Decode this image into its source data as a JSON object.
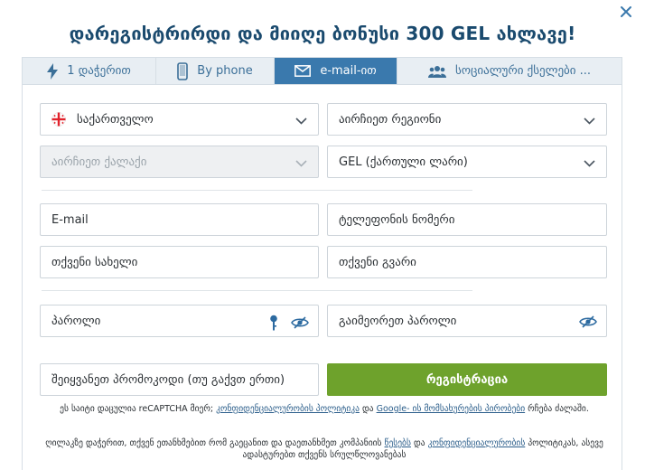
{
  "title": "დარეგისტრირდი და მიიღე ბონუსი 300 GEL ახლავე!",
  "tabs": [
    {
      "label": "1 დაჭერით",
      "icon": "lightning-icon",
      "active": false
    },
    {
      "label": "By phone",
      "icon": "phone-icon",
      "active": false
    },
    {
      "label": "e-mail-ით",
      "icon": "envelope-icon",
      "active": true
    },
    {
      "label": "სოციალური ქსელები ...",
      "icon": "users-icon",
      "active": false
    }
  ],
  "form": {
    "country": "საქართველო",
    "region": "აირჩიეთ რეგიონი",
    "city": "აირჩიეთ ქალაქი",
    "currency": "GEL (ქართული ლარი)",
    "email_placeholder": "E-mail",
    "phone_placeholder": "ტელეფონის ნომერი",
    "name_placeholder": "თქვენი სახელი",
    "surname_placeholder": "თქვენი გვარი",
    "password_placeholder": "პაროლი",
    "repeat_password_placeholder": "გაიმეორეთ პაროლი",
    "promo_placeholder": "შეიყვანეთ პრომოკოდი (თუ გაქვთ ერთი)",
    "register_label": "რეგისტრაცია"
  },
  "recaptcha_note": {
    "prefix": "ეს საიტი დაცულია reCAPTCHA მიერ;",
    "privacy_link": "კონფიდენციალურობის პოლიტიკა",
    "and": "და",
    "google_link": "Google- ის მომსახურების პირობები",
    "suffix": "რჩება ძალაში."
  },
  "consent_note": {
    "prefix": "ღილაკზე დაჭერით, თქვენ ეთანხმებით რომ გაეცანით და დაეთანხმეთ კომპანიის",
    "rules_link": "წესებს",
    "and": "და",
    "privacy_link": "კონფიდენციალურობის",
    "suffix": "პოლიტიკას, ასევე ადასტურებთ თქვენს სრულწლოვანებას"
  },
  "colors": {
    "accent": "#3a79ad",
    "title": "#1a4a6e",
    "register": "#6ea22c",
    "tab_bg": "#e8eef3"
  }
}
